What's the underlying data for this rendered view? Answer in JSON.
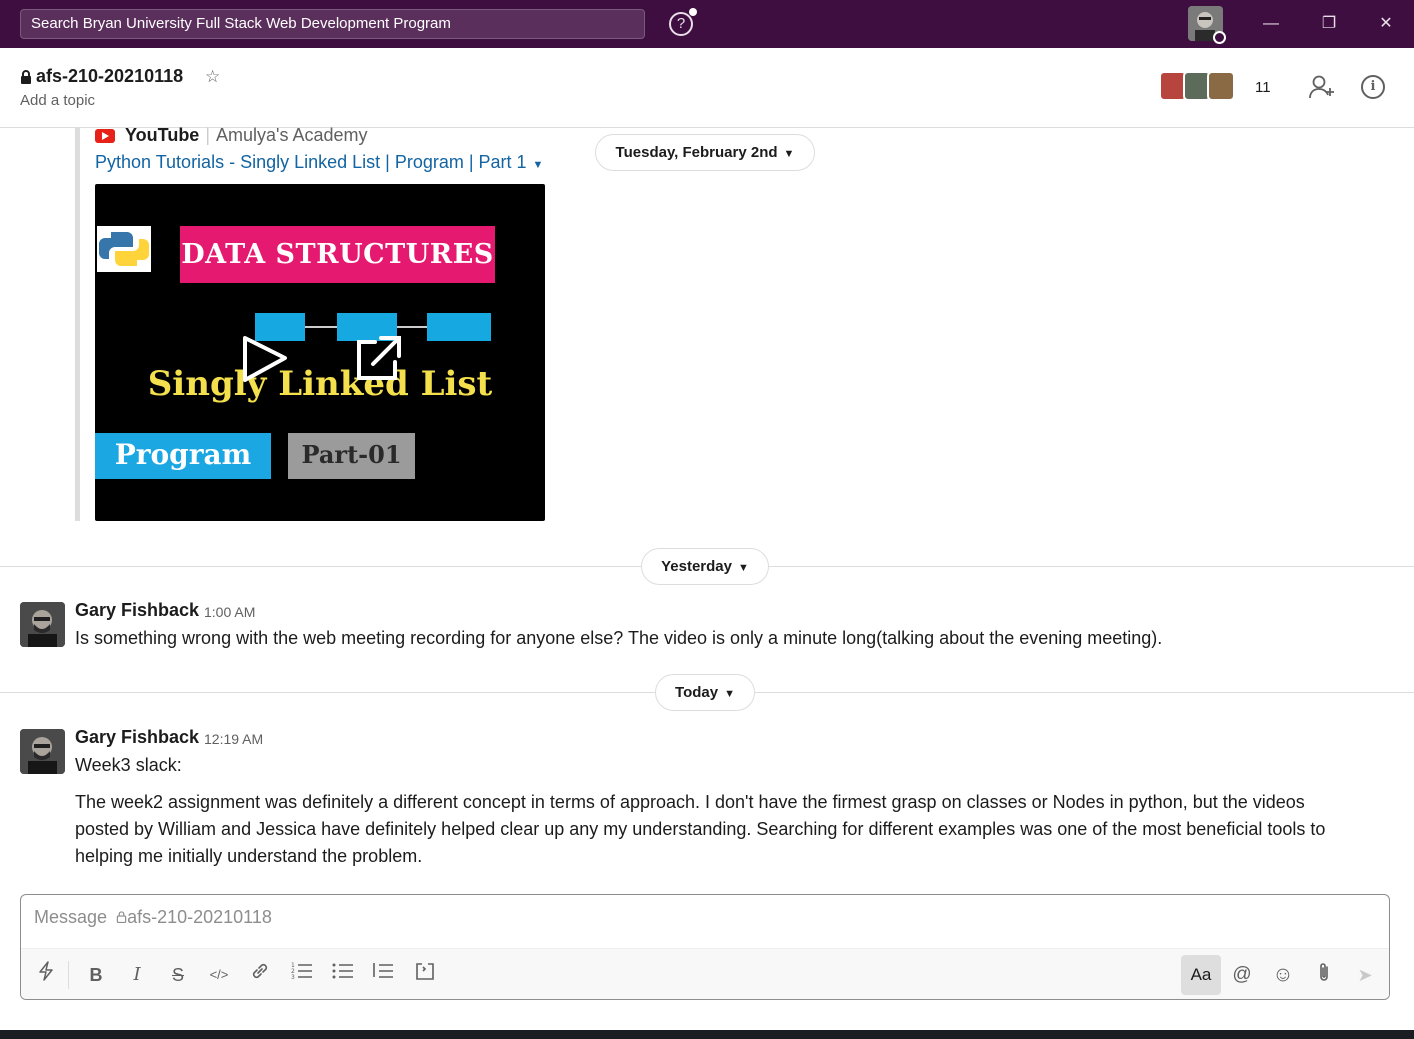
{
  "titlebar": {
    "search_placeholder": "Search Bryan University Full Stack Web Development Program",
    "help_glyph": "?",
    "minimize_glyph": "—",
    "restore_glyph": "❐",
    "close_glyph": "✕"
  },
  "channel": {
    "name": "afs-210-20210118",
    "lock_icon": "lock-icon",
    "star_glyph": "☆",
    "topic": "Add a topic",
    "member_count": "11",
    "info_glyph": "i"
  },
  "attachment": {
    "service": "YouTube",
    "author": "Amulya's Academy",
    "title": "Python Tutorials - Singly Linked List | Program | Part 1",
    "thumbnail": {
      "banner": "DATA STRUCTURES",
      "headline": "Singly Linked List",
      "tag1": "Program",
      "tag2": "Part-01"
    }
  },
  "day_dividers": {
    "tuesday": "Tuesday, February 2nd",
    "yesterday": "Yesterday",
    "today": "Today"
  },
  "messages": [
    {
      "sender": "Gary Fishback",
      "time": "1:00 AM",
      "lines": [
        "Is something wrong with the web meeting recording for anyone else? The video is only a minute long(talking about the evening meeting)."
      ]
    },
    {
      "sender": "Gary Fishback",
      "time": "12:19 AM",
      "lines": [
        "Week3 slack:",
        "The week2 assignment was definitely a different concept in terms of approach. I don't have the firmest grasp on classes or Nodes in python,  but the videos",
        "posted by William and Jessica have definitely helped clear up any my understanding. Searching for different examples was one of the most beneficial tools to",
        "helping me initially understand the problem."
      ]
    }
  ],
  "composer": {
    "placeholder_prefix": "Message",
    "placeholder_channel": "afs-210-20210118",
    "format_toggle": "Aa",
    "mention_glyph": "@",
    "emoji_glyph": "☺",
    "send_glyph": "➤"
  },
  "colors": {
    "titlebar_bg": "#3f0e40",
    "link": "#1264a3",
    "youtube_red": "#e62117"
  }
}
